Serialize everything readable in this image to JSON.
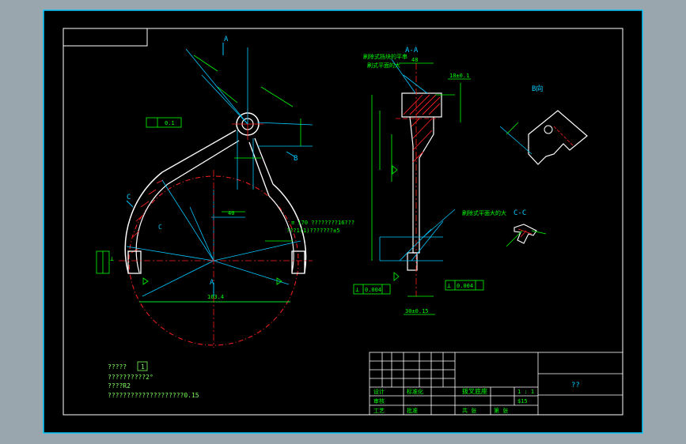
{
  "colors": {
    "window_bg": "#9aa6ae",
    "canvas_bg": "#000000",
    "frame": "#ffffff",
    "outline": "#ffffff",
    "dimension": "#00ff00",
    "hatch": "#ff2020",
    "centerline": "#ff2020",
    "aux": "#00c8ff",
    "note": "#7cff5a"
  },
  "views": {
    "main": {
      "section_a_top": "A",
      "section_a_bottom": "A",
      "view_b": "B",
      "view_c": "C",
      "view_c_dim": "C",
      "tol_frame": "0.1",
      "dim_center": "40",
      "dim_left": "⊥",
      "dim_note1": "≡ 170 ????????16???",
      "dim_note2": "???1(1)???????±5",
      "dim_bottom": "163.4"
    },
    "section_aa": {
      "title": "A-A",
      "note_top1": "刷除式挡块的平串",
      "note_top2": "刷式平面的大",
      "note_mid": "刷除式平面大的大",
      "tol_left_sym": "⊥",
      "tol_left_val": "0.004",
      "tol_right_sym": "⊥",
      "tol_right_val": "0.004",
      "dim_top": "48",
      "dim_side": "18±0.1",
      "dim_bottom": "30±0.15"
    },
    "view_b": {
      "label": "B向"
    },
    "section_cc": {
      "label": "C-C"
    }
  },
  "notes": {
    "title": "?????",
    "title_box": "1",
    "line2": "??????????2°",
    "line3": "????R2",
    "line4": "????????????????????0.15"
  },
  "title_block": {
    "title_cell": "??",
    "designer": "设计",
    "checker": "审核",
    "craft": "工艺",
    "standard": "标准化",
    "part_name": "拨叉底座",
    "scale_label": "1 : 1",
    "sheet": "共  张",
    "sheet2": "第  张",
    "material": "$15",
    "approve": "批准"
  }
}
